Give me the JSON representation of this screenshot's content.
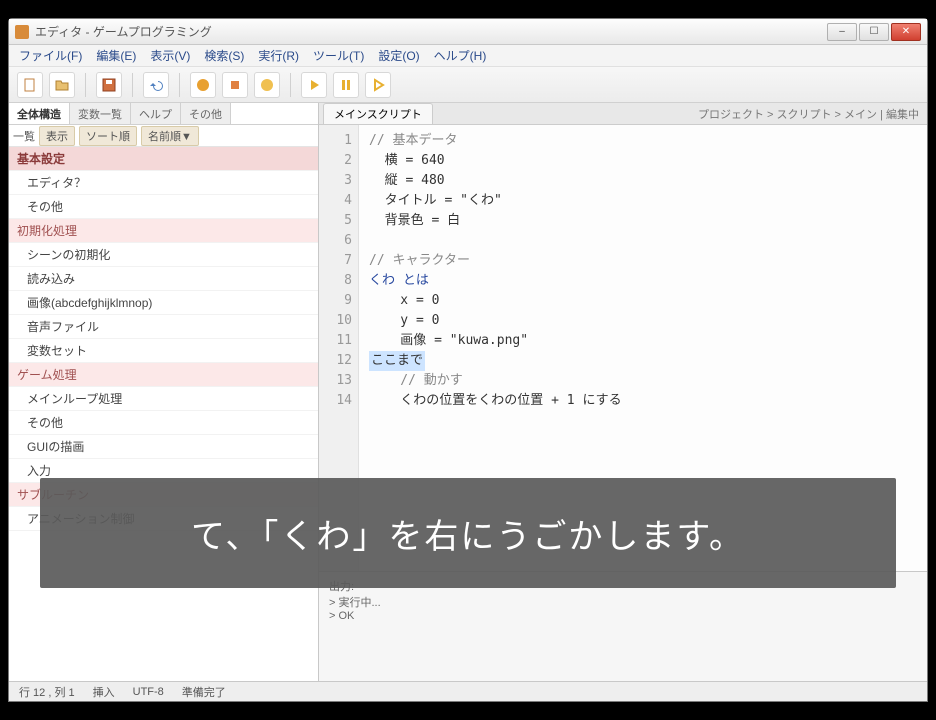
{
  "window": {
    "title": "エディタ - ゲームプログラミング"
  },
  "menu": {
    "items": [
      "ファイル(F)",
      "編集(E)",
      "表示(V)",
      "検索(S)",
      "実行(R)",
      "ツール(T)",
      "設定(O)",
      "ヘルプ(H)"
    ]
  },
  "toolbar": {
    "icons": [
      "new",
      "open",
      "save",
      "sep",
      "undo",
      "sep",
      "run",
      "stop",
      "step",
      "sep",
      "play",
      "pause",
      "step2"
    ]
  },
  "sidebar": {
    "tabs": [
      "全体構造",
      "変数一覧",
      "ヘルプ",
      "その他"
    ],
    "active_tab": 0,
    "sub": {
      "label": "一覧",
      "chips": [
        "表示",
        "ソート順",
        "名前順▼"
      ]
    },
    "items": [
      {
        "t": "group",
        "label": "基本設定"
      },
      {
        "t": "item",
        "label": "エディタ？"
      },
      {
        "t": "item",
        "label": "その他"
      },
      {
        "t": "h2",
        "label": "初期化処理"
      },
      {
        "t": "item",
        "label": "シーンの初期化"
      },
      {
        "t": "item",
        "label": "読み込み"
      },
      {
        "t": "item",
        "label": "画像(abcdefghijklmnop)"
      },
      {
        "t": "item",
        "label": "音声ファイル"
      },
      {
        "t": "item",
        "label": "変数セット"
      },
      {
        "t": "h2",
        "label": "ゲーム処理"
      },
      {
        "t": "item",
        "label": "メインループ処理"
      },
      {
        "t": "item",
        "label": "その他"
      },
      {
        "t": "item",
        "label": "GUIの描画"
      },
      {
        "t": "item",
        "label": "入力"
      },
      {
        "t": "h2",
        "label": "サブルーチン"
      },
      {
        "t": "item",
        "label": "アニメーション制御"
      }
    ]
  },
  "editor": {
    "tab_label": "メインスクリプト",
    "breadcrumb": "プロジェクト > スクリプト > メイン | 編集中",
    "lines": [
      {
        "n": 1,
        "cls": "cmt",
        "text": "// 基本データ"
      },
      {
        "n": 2,
        "cls": "",
        "text": "  横 = 640"
      },
      {
        "n": 3,
        "cls": "",
        "text": "  縦 = 480"
      },
      {
        "n": 4,
        "cls": "",
        "text": "  タイトル = \"くわ\""
      },
      {
        "n": 5,
        "cls": "",
        "text": "  背景色 = 白"
      },
      {
        "n": 6,
        "cls": "",
        "text": ""
      },
      {
        "n": 7,
        "cls": "cmt",
        "text": "// キャラクター"
      },
      {
        "n": 8,
        "cls": "kw",
        "text": "くわ とは"
      },
      {
        "n": 9,
        "cls": "",
        "text": "    x = 0"
      },
      {
        "n": 10,
        "cls": "",
        "text": "    y = 0"
      },
      {
        "n": 11,
        "cls": "",
        "text": "    画像 = \"kuwa.png\""
      },
      {
        "n": 12,
        "cls": "hl",
        "text": "ここまで"
      },
      {
        "n": 13,
        "cls": "cmt",
        "text": "    // 動かす"
      },
      {
        "n": 14,
        "cls": "",
        "text": "    くわの位置をくわの位置 + 1 にする"
      }
    ]
  },
  "lower": {
    "lines": [
      "出力:",
      "  > 実行中...",
      "  > OK"
    ]
  },
  "status": {
    "items": [
      "行 12 , 列 1",
      "挿入",
      "UTF-8",
      "準備完了"
    ]
  },
  "caption": "て、「くわ」を右にうごかします。"
}
